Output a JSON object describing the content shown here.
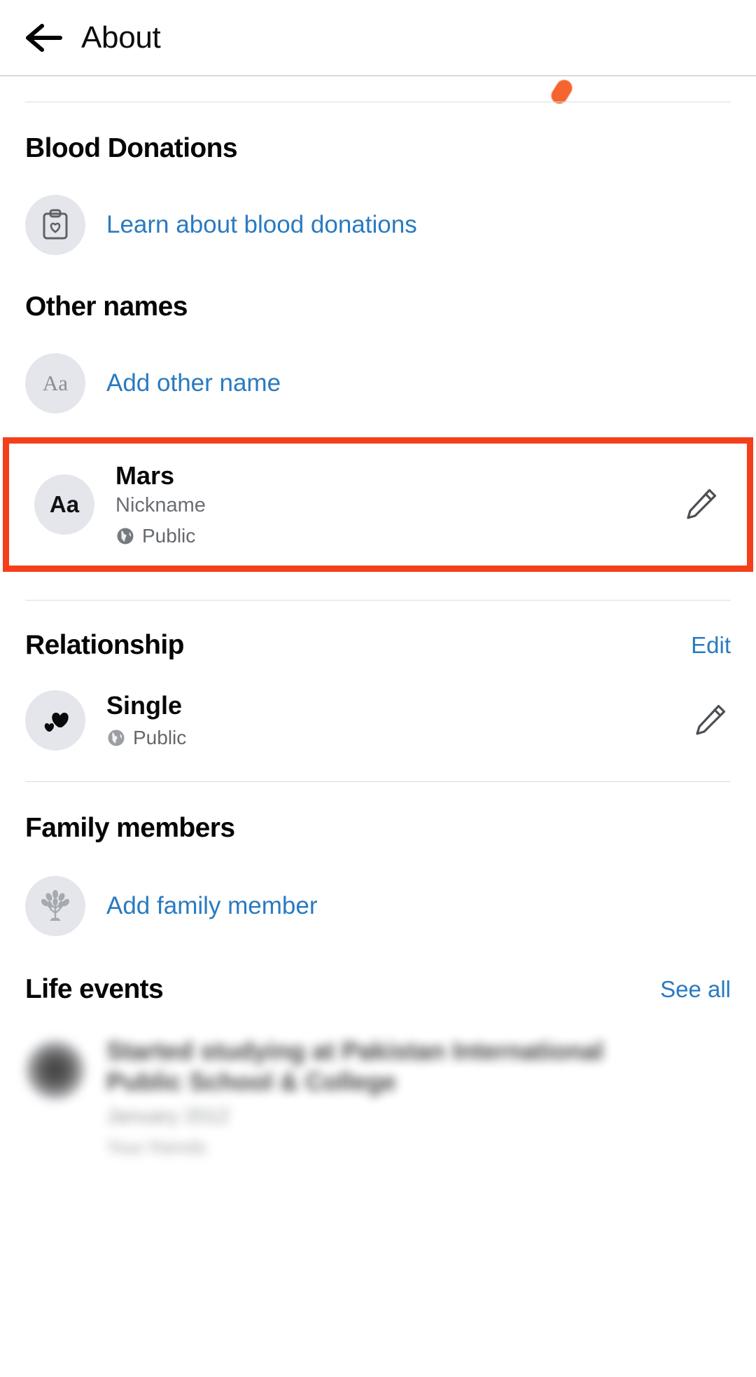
{
  "header": {
    "title": "About",
    "back_icon": "back-arrow-icon"
  },
  "annotation": {
    "dot_color": "#f4652f",
    "highlight_color": "#f4401a"
  },
  "sections": {
    "blood_donations": {
      "title": "Blood Donations",
      "link_label": "Learn about blood donations",
      "icon": "blood-donation-clipboard-icon"
    },
    "other_names": {
      "title": "Other names",
      "add_label": "Add other name",
      "add_icon": "aa-text-icon",
      "entry": {
        "icon": "aa-text-icon",
        "name": "Mars",
        "type": "Nickname",
        "privacy": "Public",
        "privacy_icon": "globe-icon",
        "edit_icon": "pencil-icon"
      }
    },
    "relationship": {
      "title": "Relationship",
      "action_label": "Edit",
      "entry": {
        "icon": "hearts-icon",
        "status": "Single",
        "privacy": "Public",
        "privacy_icon": "globe-icon",
        "edit_icon": "pencil-icon"
      }
    },
    "family_members": {
      "title": "Family members",
      "add_label": "Add family member",
      "add_icon": "family-tree-icon"
    },
    "life_events": {
      "title": "Life events",
      "action_label": "See all",
      "entry": {
        "title": "Started studying at Pakistan International Public School & College",
        "date": "January 2012",
        "privacy": "Your friends"
      }
    }
  }
}
